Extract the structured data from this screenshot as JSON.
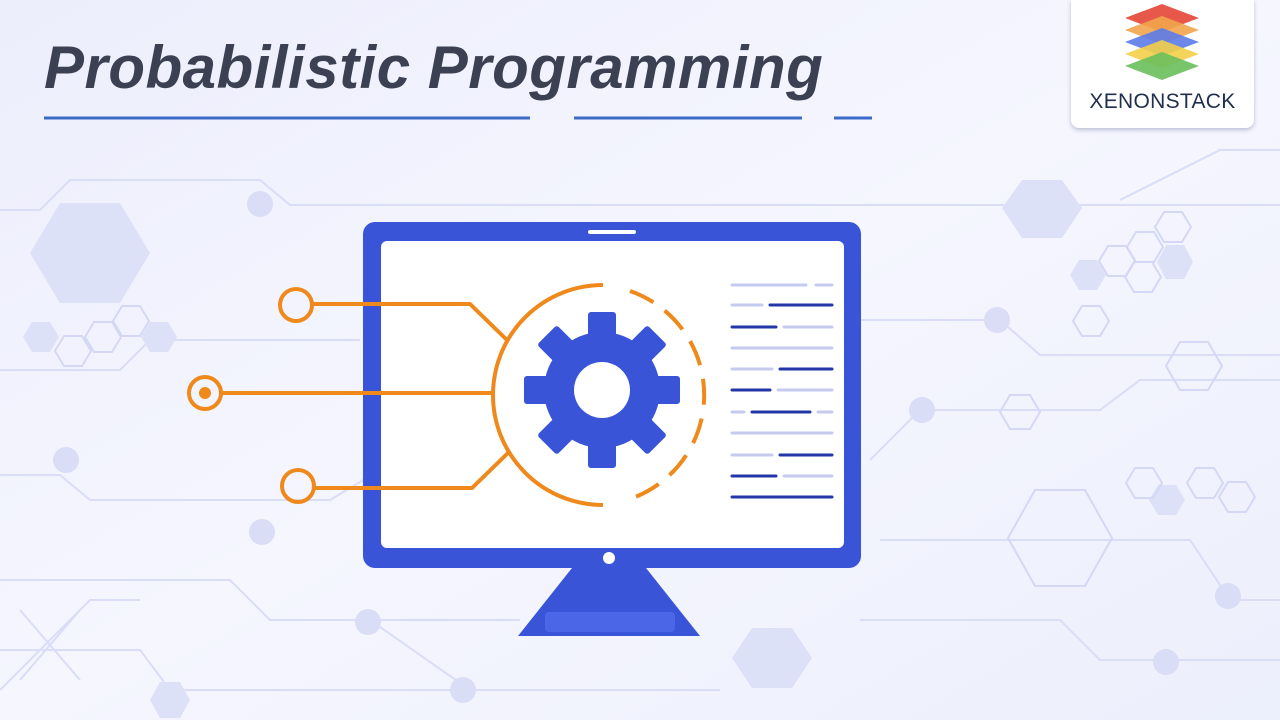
{
  "banner": {
    "title": "Probabilistic Programming",
    "brand": {
      "name": "XENONSTACK",
      "layer_colors": [
        "#e8584a",
        "#f1a54c",
        "#5b7be8",
        "#f3cf48",
        "#6abf5c"
      ]
    }
  },
  "colors": {
    "background": "#f3f4fd",
    "monitor": "#3a54d8",
    "accent": "#f0891b",
    "title_text": "#3b4152",
    "underline": "#3d6ac8"
  },
  "icons": [
    "monitor-icon",
    "gear-icon",
    "circuit-node-icon",
    "code-lines-icon"
  ]
}
